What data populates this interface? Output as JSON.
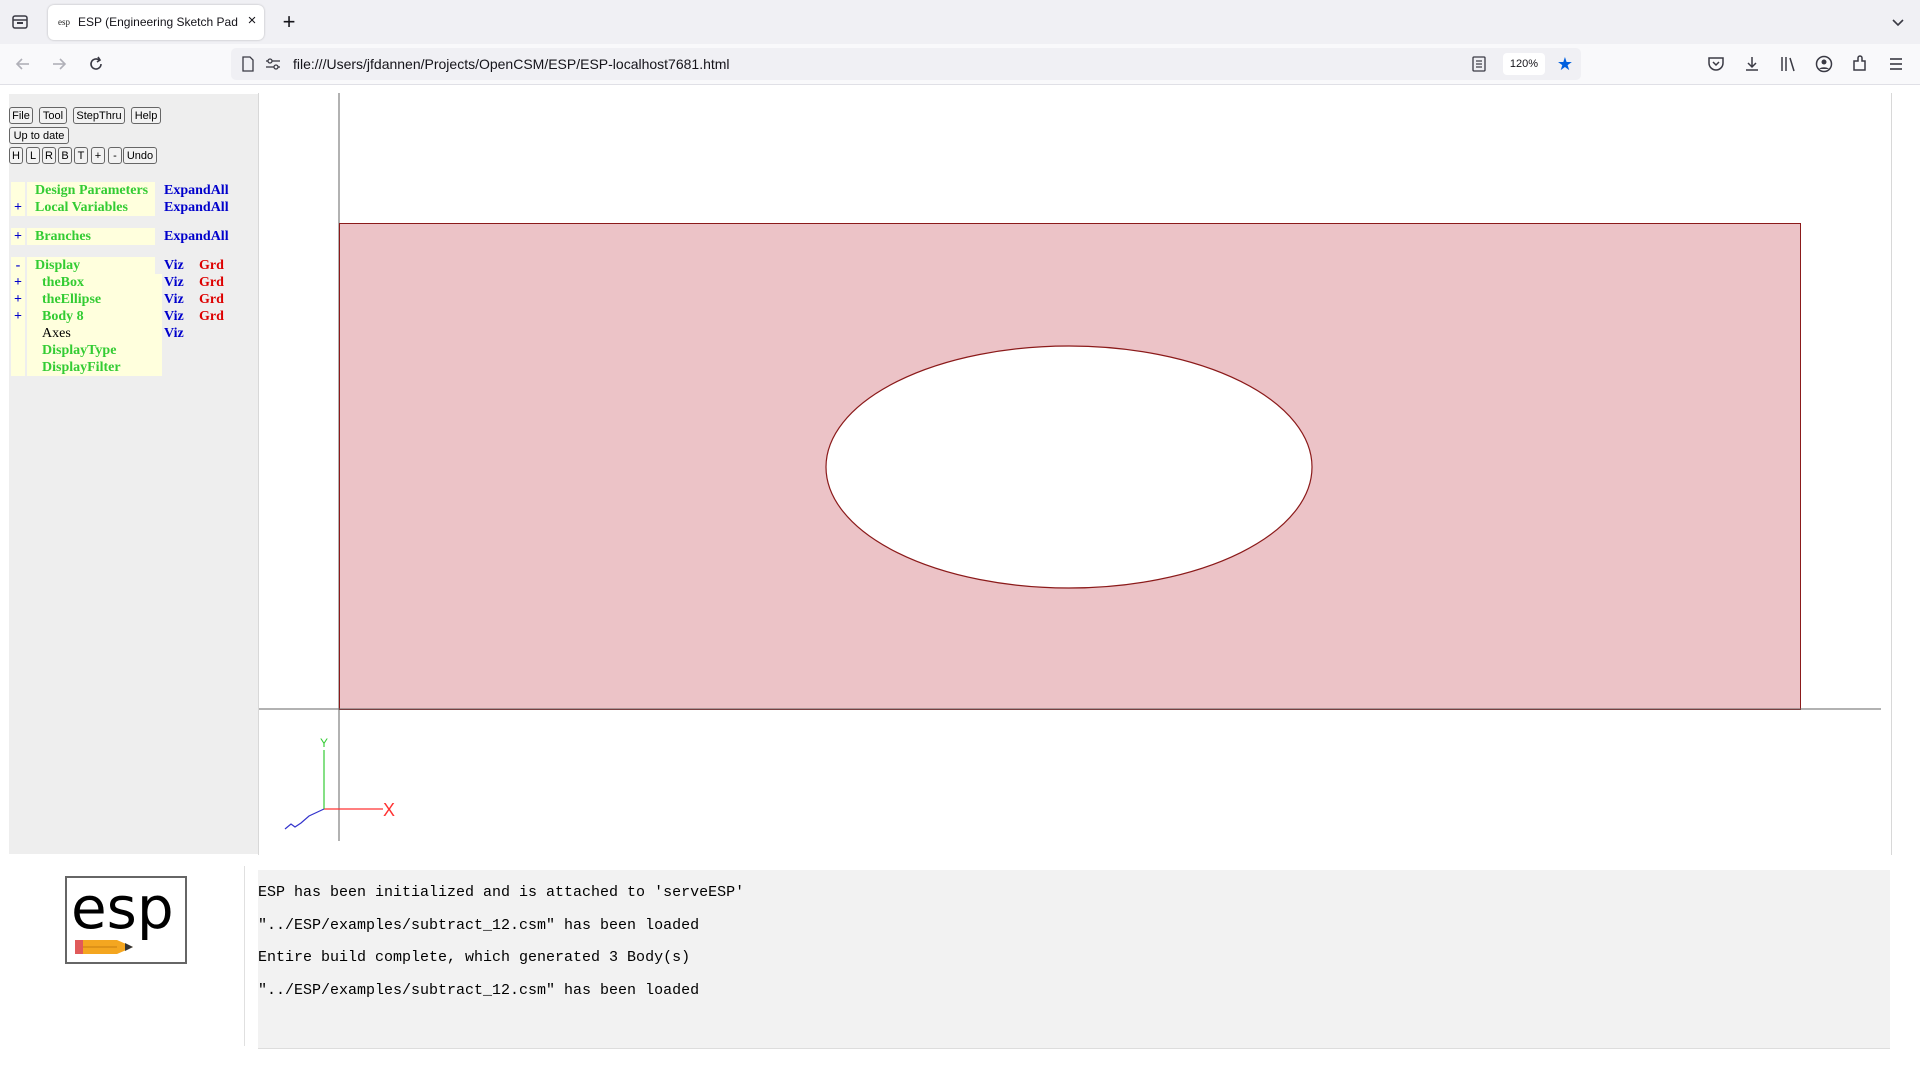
{
  "browser": {
    "tab_title": "ESP (Engineering Sketch Pad, V",
    "tab_favicon_text": "esp",
    "new_tab_label": "+",
    "close_tab_label": "×",
    "url": "file:///Users/jfdannen/Projects/OpenCSM/ESP/ESP-localhost7681.html",
    "zoom": "120%",
    "icons": [
      "tab-list-icon",
      "back-icon",
      "forward-icon",
      "reload-icon",
      "page-icon",
      "permissions-icon",
      "reader-view-icon",
      "bookmark-star-icon",
      "pocket-icon",
      "downloads-icon",
      "library-icon",
      "account-icon",
      "extensions-icon",
      "menu-icon",
      "list-all-tabs-icon"
    ],
    "accent_color": "#0060df"
  },
  "toolbar": {
    "file": "File",
    "tool": "Tool",
    "stepthru": "StepThru",
    "help": "Help",
    "status": "Up to date",
    "view_buttons": [
      "H",
      "L",
      "R",
      "B",
      "T",
      "+",
      "-"
    ],
    "undo": "Undo"
  },
  "tree": {
    "design_parameters": {
      "sign": "",
      "name": "Design Parameters",
      "action": "ExpandAll"
    },
    "local_variables": {
      "sign": "+",
      "name": "Local Variables",
      "action": "ExpandAll"
    },
    "branches": {
      "sign": "+",
      "name": "Branches",
      "action": "ExpandAll"
    },
    "display": {
      "sign": "-",
      "name": "Display",
      "viz": "Viz",
      "grd": "Grd"
    },
    "the_box": {
      "sign": "+",
      "name": "theBox",
      "viz": "Viz",
      "grd": "Grd"
    },
    "the_ellipse": {
      "sign": "+",
      "name": "theEllipse",
      "viz": "Viz",
      "grd": "Grd"
    },
    "body8": {
      "sign": "+",
      "name": "Body 8",
      "viz": "Viz",
      "grd": "Grd"
    },
    "axes": {
      "name": "Axes",
      "viz": "Viz"
    },
    "display_type": {
      "name": "DisplayType"
    },
    "display_filter": {
      "name": "DisplayFilter"
    },
    "colors": {
      "label": "#33cc33",
      "action": "#0000cc",
      "grd": "#dd0000",
      "cell": "#ffffdd"
    }
  },
  "graphics": {
    "body_fill": "#ecc3c7",
    "edge_color": "#8b1a1a",
    "axis_labels": {
      "x": "X",
      "y": "Y"
    }
  },
  "logo": {
    "text": "esp"
  },
  "messages": [
    "ESP has been initialized and is attached to 'serveESP'",
    "\"../ESP/examples/subtract_12.csm\" has been loaded",
    "Entire build complete, which generated 3 Body(s)",
    "\"../ESP/examples/subtract_12.csm\" has been loaded"
  ]
}
